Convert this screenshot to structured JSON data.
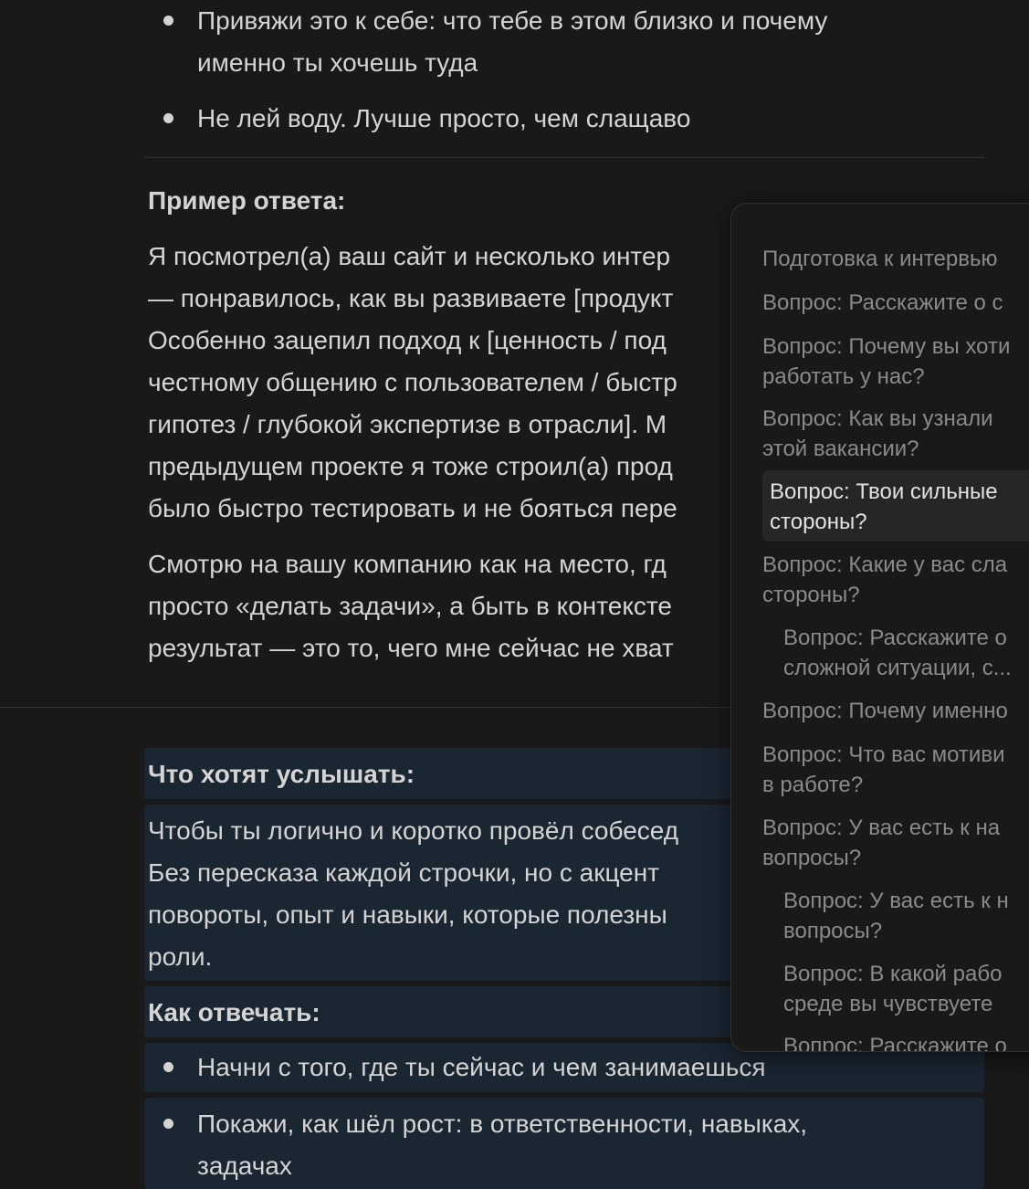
{
  "top_bullets": [
    {
      "lines": [
        "Привяжи это к себе: что тебе в этом близко и почему",
        "именно ты хочешь туда"
      ]
    },
    {
      "lines": [
        "Не лей воду. Лучше просто, чем слащаво"
      ]
    }
  ],
  "example": {
    "heading": "Пример ответа:",
    "para1_lines": [
      "Я посмотрел(а) ваш сайт и несколько интер",
      "— понравилось, как вы развиваете [продукт",
      "Особенно зацепил подход к [ценность / под",
      "честному общению с пользователем / быстр",
      "гипотез / глубокой экспертизе в отрасли]. М",
      "предыдущем проекте я тоже строил(а) прод",
      "было быстро тестировать и не бояться пере"
    ],
    "para2_lines": [
      "Смотрю на вашу компанию как на место, гд",
      "просто «делать задачи», а быть в контексте",
      "результат — это то, чего мне сейчас не хват"
    ]
  },
  "want_to_hear": {
    "heading": "Что хотят услышать:",
    "lines": [
      "Чтобы ты логично и коротко провёл собесед",
      "Без пересказа каждой строчки, но с акцент",
      "повороты, опыт и навыки, которые полезны",
      "роли."
    ]
  },
  "how_to_answer": {
    "heading": "Как отвечать:",
    "bullets": [
      {
        "lines": [
          "Начни с того, где ты сейчас и чем занимаешься"
        ]
      },
      {
        "lines": [
          "Покажи, как шёл рост: в ответственности, навыках,",
          "задачах"
        ]
      }
    ]
  },
  "outline": {
    "items": [
      {
        "lines": [
          "Подготовка к интервью"
        ],
        "sub": false,
        "active": false
      },
      {
        "lines": [
          "Вопрос: Расскажите о с"
        ],
        "sub": false,
        "active": false
      },
      {
        "lines": [
          "Вопрос: Почему вы хоти",
          "работать у нас?"
        ],
        "sub": false,
        "active": false
      },
      {
        "lines": [
          "Вопрос: Как вы узнали",
          "этой вакансии?"
        ],
        "sub": false,
        "active": false
      },
      {
        "lines": [
          "Вопрос: Твои сильные",
          "стороны?"
        ],
        "sub": false,
        "active": true
      },
      {
        "lines": [
          "Вопрос: Какие у вас сла",
          "стороны?"
        ],
        "sub": false,
        "active": false
      },
      {
        "lines": [
          "Вопрос: Расскажите о",
          "сложной ситуации, с..."
        ],
        "sub": true,
        "active": false
      },
      {
        "lines": [
          "Вопрос: Почему именно"
        ],
        "sub": false,
        "active": false
      },
      {
        "lines": [
          "Вопрос: Что вас мотиви",
          "в работе?"
        ],
        "sub": false,
        "active": false
      },
      {
        "lines": [
          "Вопрос: У вас есть к на",
          "вопросы?"
        ],
        "sub": false,
        "active": false
      },
      {
        "lines": [
          "Вопрос: У вас есть к н",
          "вопросы?"
        ],
        "sub": true,
        "active": false
      },
      {
        "lines": [
          "Вопрос: В какой рабо",
          "среде вы чувствуете"
        ],
        "sub": true,
        "active": false
      },
      {
        "lines": [
          "Вопрос: Расскажите о"
        ],
        "sub": true,
        "active": false
      }
    ]
  },
  "colors": {
    "background": "#191919",
    "text": "#d4d4d4",
    "highlight": "#1b2633",
    "outline_text": "#8a8a8a",
    "outline_active": "#e2e2e2"
  }
}
